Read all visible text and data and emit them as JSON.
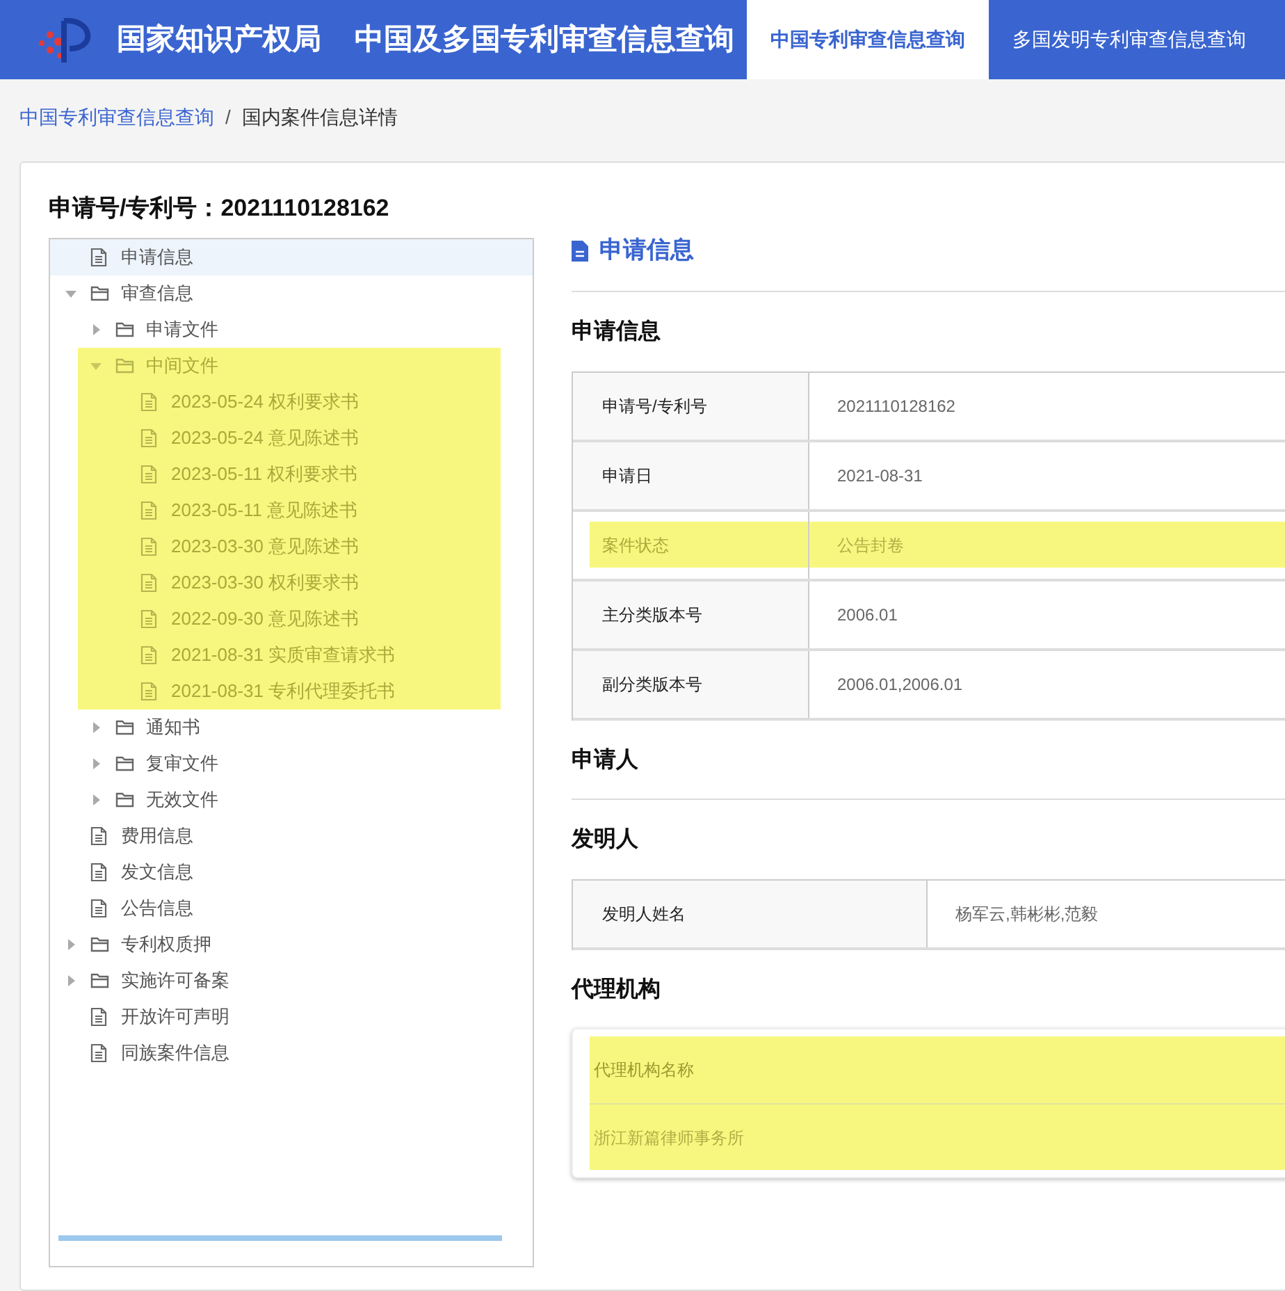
{
  "header": {
    "site_name": "国家知识产权局",
    "title": "中国及多国专利审查信息查询",
    "tabs": [
      {
        "label": "中国专利审查信息查询",
        "selected": true
      },
      {
        "label": "多国发明专利审查信息查询",
        "selected": false
      }
    ]
  },
  "breadcrumb": {
    "items": [
      {
        "label": "中国专利审查信息查询",
        "kind": "link"
      },
      {
        "label": "国内案件信息详情",
        "kind": "current"
      }
    ],
    "separator": "/"
  },
  "case_heading": "申请号/专利号：2021110128162",
  "tree": [
    {
      "label": "申请信息",
      "kind": "file",
      "selected": true,
      "highlighted": false
    },
    {
      "label": "审查信息",
      "kind": "folder",
      "expanded": true,
      "selected": false,
      "highlighted": false,
      "children": [
        {
          "label": "申请文件",
          "kind": "folder",
          "expanded": false,
          "selected": false,
          "highlighted": false
        },
        {
          "label": "中间文件",
          "kind": "folder",
          "expanded": true,
          "selected": false,
          "highlighted": true,
          "children": [
            {
              "label": "2023-05-24 权利要求书",
              "kind": "file",
              "selected": false,
              "highlighted": false
            },
            {
              "label": "2023-05-24 意见陈述书",
              "kind": "file",
              "selected": false,
              "highlighted": false
            },
            {
              "label": "2023-05-11 权利要求书",
              "kind": "file",
              "selected": false,
              "highlighted": false
            },
            {
              "label": "2023-05-11 意见陈述书",
              "kind": "file",
              "selected": false,
              "highlighted": false
            },
            {
              "label": "2023-03-30 意见陈述书",
              "kind": "file",
              "selected": false,
              "highlighted": false
            },
            {
              "label": "2023-03-30 权利要求书",
              "kind": "file",
              "selected": false,
              "highlighted": false
            },
            {
              "label": "2022-09-30 意见陈述书",
              "kind": "file",
              "selected": false,
              "highlighted": false
            },
            {
              "label": "2021-08-31 实质审查请求书",
              "kind": "file",
              "selected": false,
              "highlighted": false
            },
            {
              "label": "2021-08-31 专利代理委托书",
              "kind": "file",
              "selected": false,
              "highlighted": false
            }
          ]
        },
        {
          "label": "通知书",
          "kind": "folder",
          "expanded": false,
          "selected": false,
          "highlighted": false
        },
        {
          "label": "复审文件",
          "kind": "folder",
          "expanded": false,
          "selected": false,
          "highlighted": false
        },
        {
          "label": "无效文件",
          "kind": "folder",
          "expanded": false,
          "selected": false,
          "highlighted": false
        }
      ]
    },
    {
      "label": "费用信息",
      "kind": "file",
      "selected": false,
      "highlighted": false
    },
    {
      "label": "发文信息",
      "kind": "file",
      "selected": false,
      "highlighted": false
    },
    {
      "label": "公告信息",
      "kind": "file",
      "selected": false,
      "highlighted": false
    },
    {
      "label": "专利权质押",
      "kind": "folder",
      "expanded": false,
      "selected": false,
      "highlighted": false
    },
    {
      "label": "实施许可备案",
      "kind": "folder",
      "expanded": false,
      "selected": false,
      "highlighted": false
    },
    {
      "label": "开放许可声明",
      "kind": "file",
      "selected": false,
      "highlighted": false
    },
    {
      "label": "同族案件信息",
      "kind": "file",
      "selected": false,
      "highlighted": false
    }
  ],
  "detail": {
    "panel_title": "申请信息",
    "sections": [
      {
        "kind": "table",
        "title": "申请信息",
        "rows": [
          {
            "label": "申请号/专利号",
            "value": "2021110128162",
            "highlighted": false
          },
          {
            "label": "申请日",
            "value": "2021-08-31",
            "highlighted": false
          },
          {
            "label": "案件状态",
            "value": "公告封卷",
            "highlighted": true
          },
          {
            "label": "主分类版本号",
            "value": "2006.01",
            "highlighted": false
          },
          {
            "label": "副分类版本号",
            "value": "2006.01,2006.01",
            "highlighted": false
          }
        ]
      },
      {
        "kind": "empty",
        "title": "申请人"
      },
      {
        "kind": "table",
        "title": "发明人",
        "rows": [
          {
            "label": "发明人姓名",
            "value": "杨军云,韩彬彬,范毅",
            "highlighted": false
          }
        ]
      },
      {
        "kind": "stacked",
        "title": "代理机构",
        "highlighted": true,
        "rows": [
          {
            "text": "代理机构名称",
            "kind": "header"
          },
          {
            "text": "浙江新篇律师事务所",
            "kind": "value"
          }
        ]
      }
    ]
  }
}
